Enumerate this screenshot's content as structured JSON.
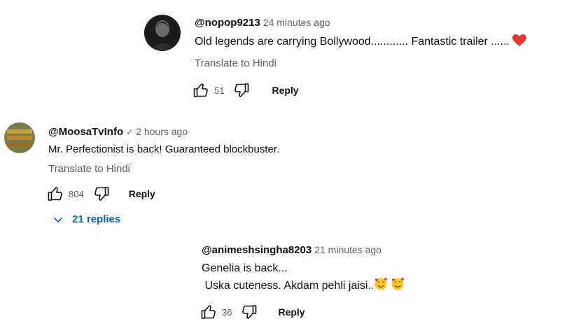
{
  "comments": [
    {
      "author": "@nopop9213",
      "time": "24 minutes ago",
      "verified": "",
      "text_lines": [
        "Old legends are carrying Bollywood............ Fantastic trailer ......"
      ],
      "translate_label": "Translate to Hindi",
      "likes": "51",
      "reply_label": "Reply"
    },
    {
      "author": "@MoosaTvInfo",
      "time": "2 hours ago",
      "verified": "✓",
      "text_lines": [
        "Mr. Perfectionist is back! Guaranteed blockbuster."
      ],
      "translate_label": "Translate to Hindi",
      "likes": "804",
      "reply_label": "Reply",
      "replies_label": "21 replies"
    },
    {
      "author": "@animeshsingha8203",
      "time": "21 minutes ago",
      "verified": "",
      "text_lines": [
        "Genelia is back...",
        " Uska cuteness. Akdam pehli jaisi.."
      ],
      "likes": "36",
      "reply_label": "Reply"
    }
  ],
  "colors": {
    "link": "#065fd4",
    "secondary": "#606060",
    "heart": "#e53935"
  },
  "icons": [
    "like-icon",
    "dislike-icon",
    "chevron-down-icon",
    "heart-emoji",
    "smiling-face-with-hearts-emoji"
  ]
}
